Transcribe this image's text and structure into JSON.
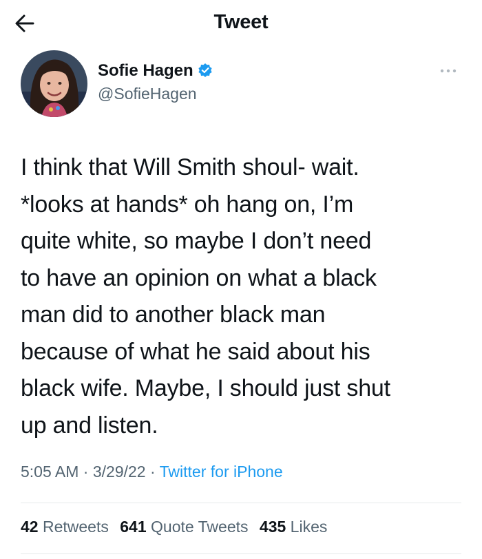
{
  "header": {
    "title": "Tweet",
    "back_icon": "arrow-left-icon"
  },
  "author": {
    "name": "Sofie Hagen",
    "handle": "@SofieHagen",
    "verified": true,
    "verified_color": "#1d9bf0"
  },
  "tweet": {
    "text_lines": [
      "I think that Will Smith shoul- wait.",
      "*looks at hands* oh hang on, I’m",
      "quite white, so maybe I don’t need",
      "to have an opinion on what a black",
      "man did to another black man",
      "because of what he said about his",
      "black wife. Maybe, I should just shut",
      "up and listen."
    ],
    "time": "5:05 AM",
    "date": "3/29/22",
    "source": "Twitter for iPhone"
  },
  "stats": {
    "retweets_count": "42",
    "retweets_label": "Retweets",
    "quotes_count": "641",
    "quotes_label": "Quote Tweets",
    "likes_count": "435",
    "likes_label": "Likes"
  },
  "colors": {
    "text": "#0f1419",
    "secondary": "#536471",
    "link": "#1d9bf0",
    "divider": "#e6e9ea"
  }
}
